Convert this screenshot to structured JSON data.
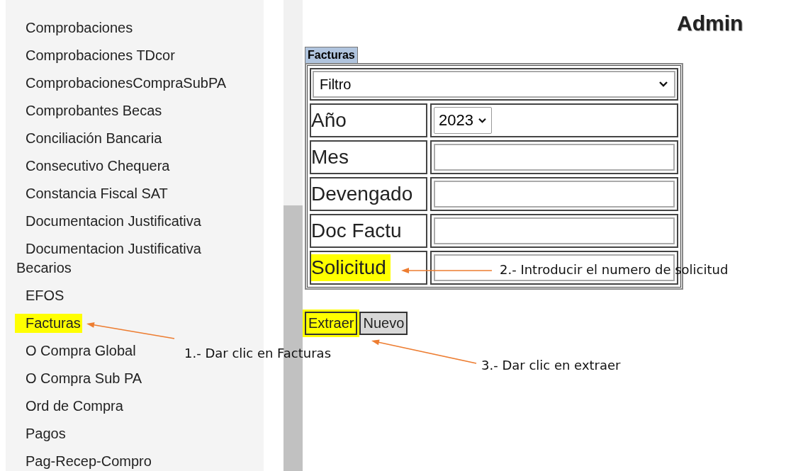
{
  "sidebar": {
    "items": [
      {
        "label": "Comprobaciones",
        "highlighted": false
      },
      {
        "label": "Comprobaciones TDcor",
        "highlighted": false
      },
      {
        "label": "ComprobacionesCompraSubPA",
        "highlighted": false
      },
      {
        "label": "Comprobantes Becas",
        "highlighted": false
      },
      {
        "label": "Conciliación Bancaria",
        "highlighted": false
      },
      {
        "label": "Consecutivo Chequera",
        "highlighted": false
      },
      {
        "label": "Constancia Fiscal SAT",
        "highlighted": false
      },
      {
        "label": "Documentacion Justificativa",
        "highlighted": false
      },
      {
        "label": "Documentacion Justificativa Becarios",
        "highlighted": false
      },
      {
        "label": "EFOS",
        "highlighted": false
      },
      {
        "label": "Facturas",
        "highlighted": true
      },
      {
        "label": "O Compra Global",
        "highlighted": false
      },
      {
        "label": "O Compra Sub PA",
        "highlighted": false
      },
      {
        "label": "Ord de Compra",
        "highlighted": false
      },
      {
        "label": "Pagos",
        "highlighted": false
      },
      {
        "label": "Pag-Recep-Compro",
        "highlighted": false
      }
    ]
  },
  "header": {
    "title": "Admin"
  },
  "form": {
    "tab": "Facturas",
    "filter": {
      "value": "Filtro"
    },
    "rows": [
      {
        "label": "Año",
        "kind": "select",
        "value": "2023",
        "highlighted": false
      },
      {
        "label": "Mes",
        "kind": "text",
        "highlighted": false
      },
      {
        "label": "Devengado",
        "kind": "text",
        "highlighted": false
      },
      {
        "label": "Doc Factu",
        "kind": "text",
        "highlighted": false
      },
      {
        "label": "Solicitud",
        "kind": "text",
        "highlighted": true
      }
    ]
  },
  "buttons": [
    {
      "label": "Extraer",
      "highlighted": true
    },
    {
      "label": "Nuevo",
      "highlighted": false
    }
  ],
  "annotations": [
    {
      "text": "1.- Dar clic en Facturas"
    },
    {
      "text": "2.- Introducir el numero de solicitud"
    },
    {
      "text": "3.- Dar clic en extraer"
    }
  ]
}
